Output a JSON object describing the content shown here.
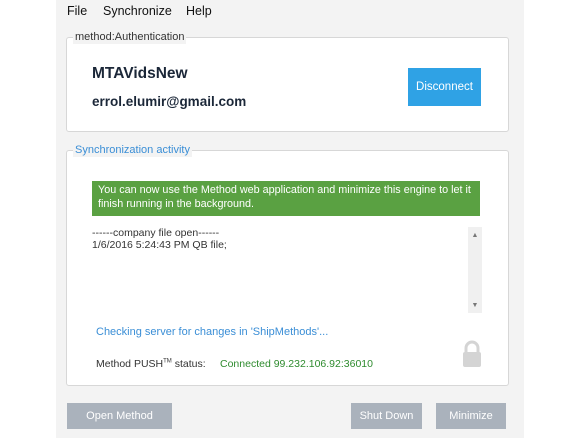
{
  "menu": {
    "items": [
      "File",
      "Synchronize",
      "Help"
    ]
  },
  "auth": {
    "legend": "method:Authentication",
    "account_name": "MTAVidsNew",
    "email": "errol.elumir@gmail.com",
    "disconnect_label": "Disconnect"
  },
  "sync": {
    "legend": "Synchronization activity",
    "banner": "You can now use the Method web application and minimize this engine to let it finish running in the background.",
    "log_lines": [
      "------company file open------",
      "1/6/2016 5:24:43 PM QB file;"
    ],
    "checking_text": "Checking server for changes in 'ShipMethods'...",
    "status_label_main": "Method PUSH",
    "status_label_mark": "TM",
    "status_label_suffix": " status:",
    "status_value": "Connected 99.232.106.92:36010"
  },
  "buttons": {
    "open_method": "Open Method",
    "shut_down": "Shut Down",
    "minimize": "Minimize"
  },
  "colors": {
    "accent_blue": "#2fa2e5",
    "banner_green": "#5aa142",
    "status_green": "#2e8b2e",
    "button_gray": "#aab2bc"
  },
  "icons": {
    "scroll_up": "scroll-up-arrow",
    "scroll_down": "scroll-down-arrow",
    "lock": "lock-icon"
  }
}
